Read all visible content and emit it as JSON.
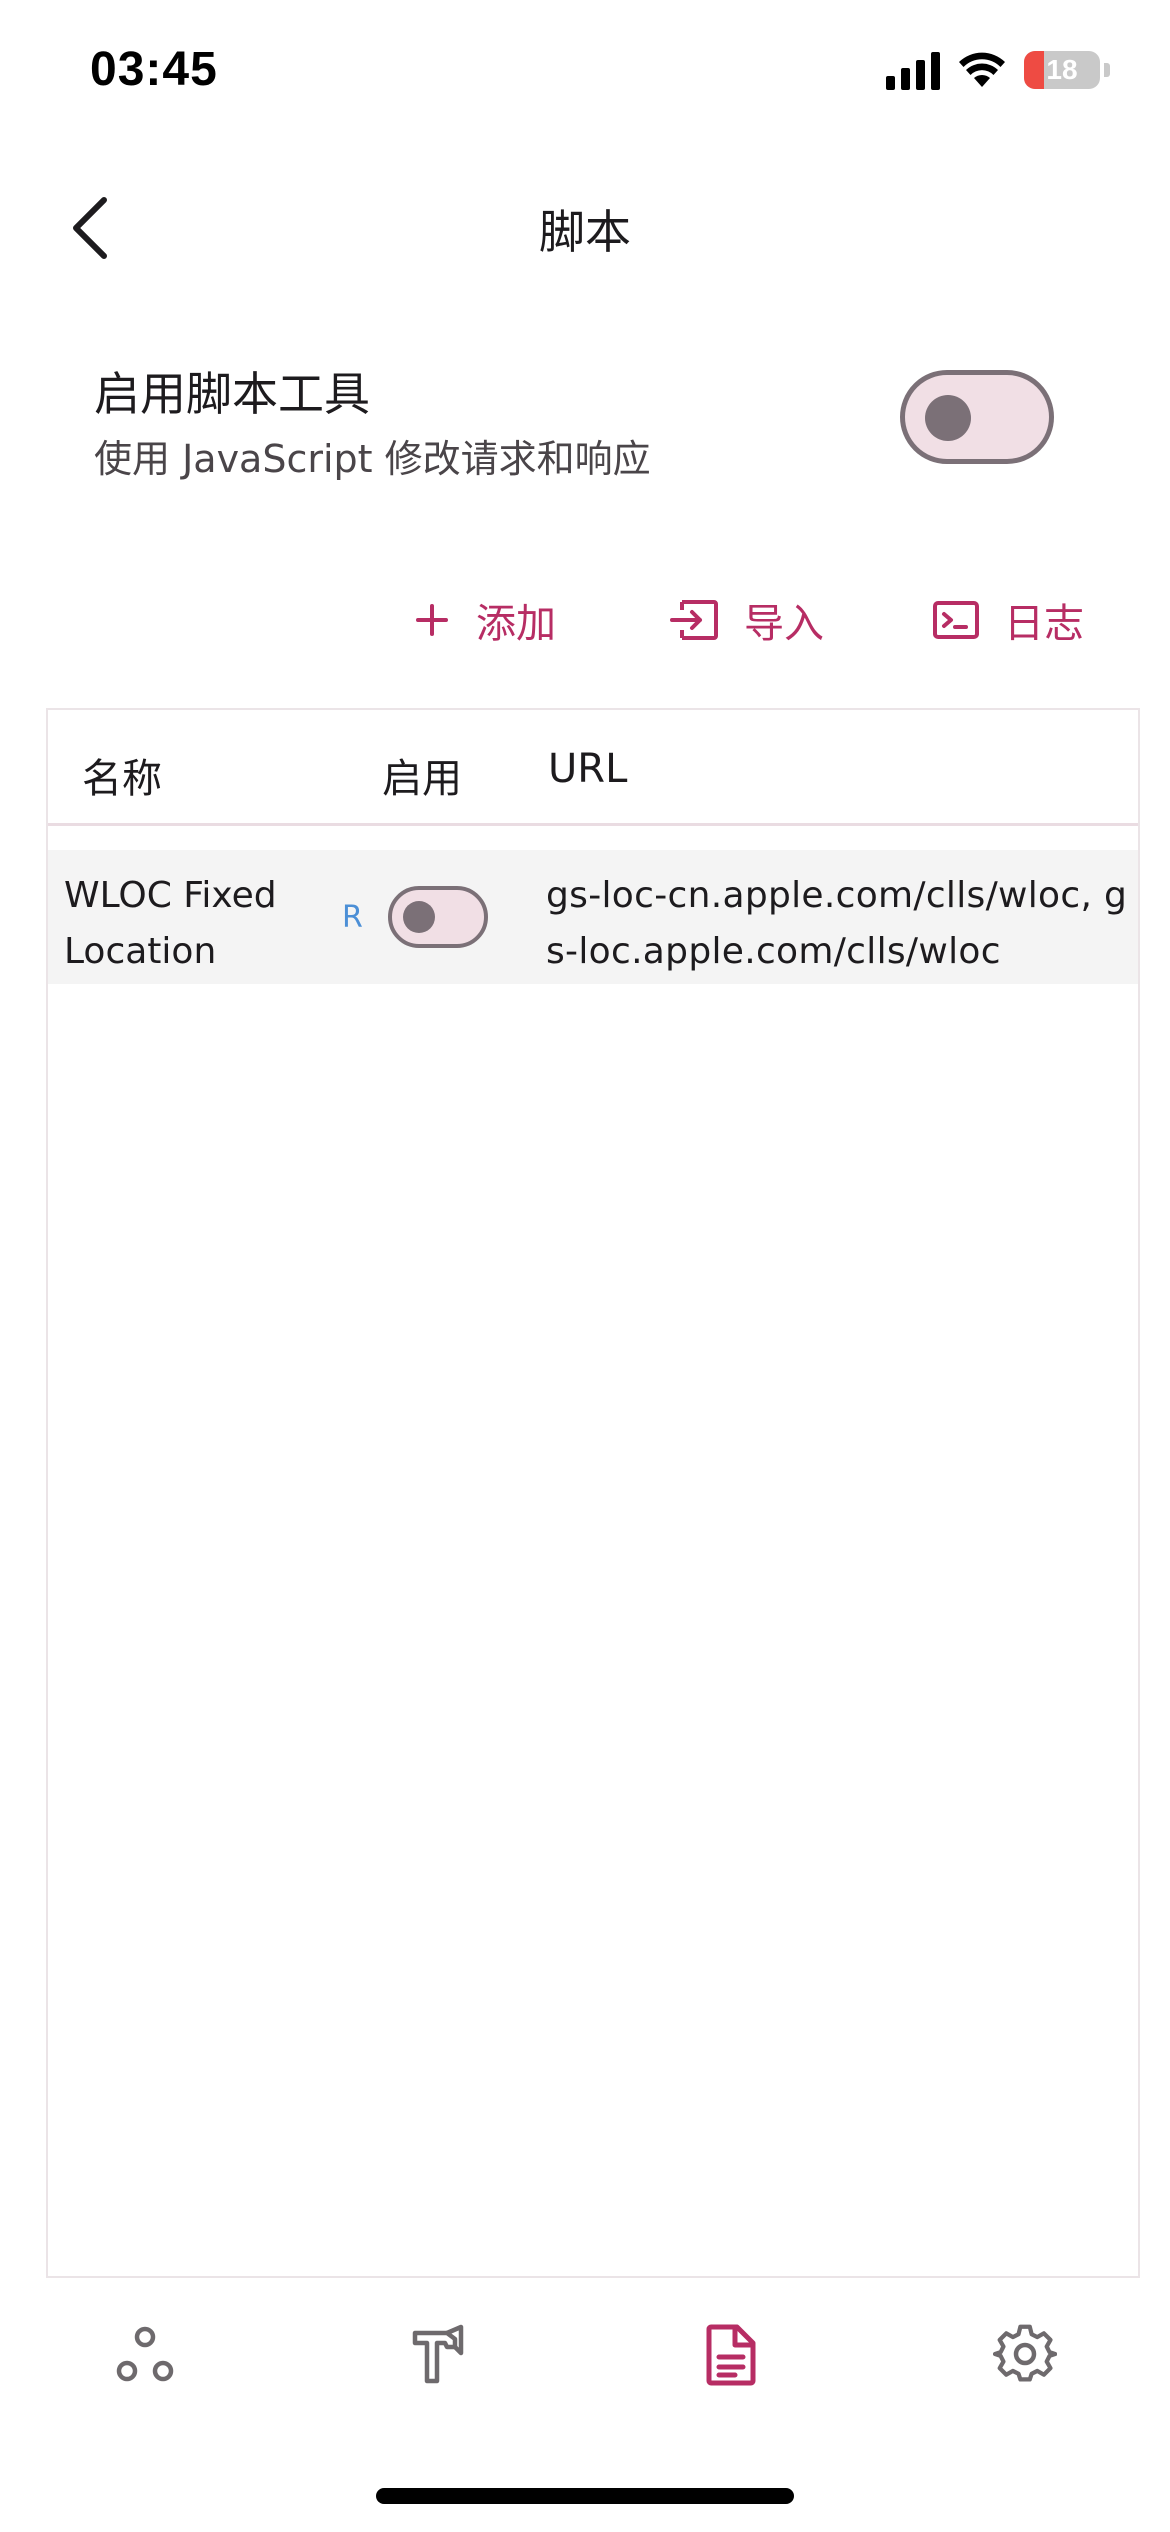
{
  "status_bar": {
    "time": "03:45",
    "battery": "18"
  },
  "header": {
    "title": "脚本"
  },
  "enable_section": {
    "title": "启用脚本工具",
    "subtitle": "使用 JavaScript 修改请求和响应",
    "enabled": false
  },
  "actions": {
    "add": "添加",
    "import": "导入",
    "log": "日志"
  },
  "table": {
    "columns": [
      "名称",
      "启用",
      "URL"
    ],
    "rows": [
      {
        "name": "WLOC Fixed Location",
        "badge": "R",
        "enabled": false,
        "url": "gs-loc-cn.apple.com/clls/wloc, gs-loc.apple.com/clls/wloc"
      }
    ]
  },
  "bottom_nav": {
    "items": [
      "network-icon",
      "toolbox-icon",
      "script-document-icon",
      "settings-gear-icon"
    ],
    "active_index": 2
  },
  "colors": {
    "accent": "#b72d64",
    "switch_track": "#f1dfe5",
    "switch_border": "#7b7077",
    "badge": "#4c8fd6",
    "icon_inactive": "#6e6a6d"
  }
}
